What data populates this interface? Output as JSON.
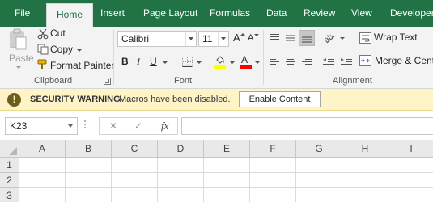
{
  "tabs": [
    {
      "label": "File",
      "active": false
    },
    {
      "label": "Home",
      "active": true
    },
    {
      "label": "Insert",
      "active": false
    },
    {
      "label": "Page Layout",
      "active": false
    },
    {
      "label": "Formulas",
      "active": false
    },
    {
      "label": "Data",
      "active": false
    },
    {
      "label": "Review",
      "active": false
    },
    {
      "label": "View",
      "active": false
    },
    {
      "label": "Developer",
      "active": false
    }
  ],
  "clipboard": {
    "paste_label": "Paste",
    "cut_label": "Cut",
    "copy_label": "Copy",
    "format_painter_label": "Format Painter",
    "group_label": "Clipboard"
  },
  "font": {
    "font_name": "Calibri",
    "font_size": "11",
    "bold_label": "B",
    "italic_label": "I",
    "underline_label": "U",
    "grow_label": "A",
    "shrink_label": "A",
    "font_color_label": "A",
    "group_label": "Font",
    "highlight_color": "#ffff00",
    "font_color": "#ff0000"
  },
  "alignment": {
    "wrap_text_label": "Wrap Text",
    "merge_label": "Merge & Center",
    "group_label": "Alignment"
  },
  "security": {
    "icon_glyph": "!",
    "title": "SECURITY WARNING",
    "message": "Macros have been disabled.",
    "button_label": "Enable Content"
  },
  "formula_bar": {
    "name_box": "K23",
    "cancel_glyph": "✕",
    "enter_glyph": "✓",
    "fx_label": "fx",
    "formula": ""
  },
  "grid": {
    "columns": [
      "A",
      "B",
      "C",
      "D",
      "E",
      "F",
      "G",
      "H",
      "I"
    ],
    "rows": [
      "1",
      "2",
      "3"
    ]
  },
  "colors": {
    "excel_green": "#217346",
    "ribbon_bg": "#f3f3f3",
    "security_bar_bg": "#fff4c8"
  }
}
